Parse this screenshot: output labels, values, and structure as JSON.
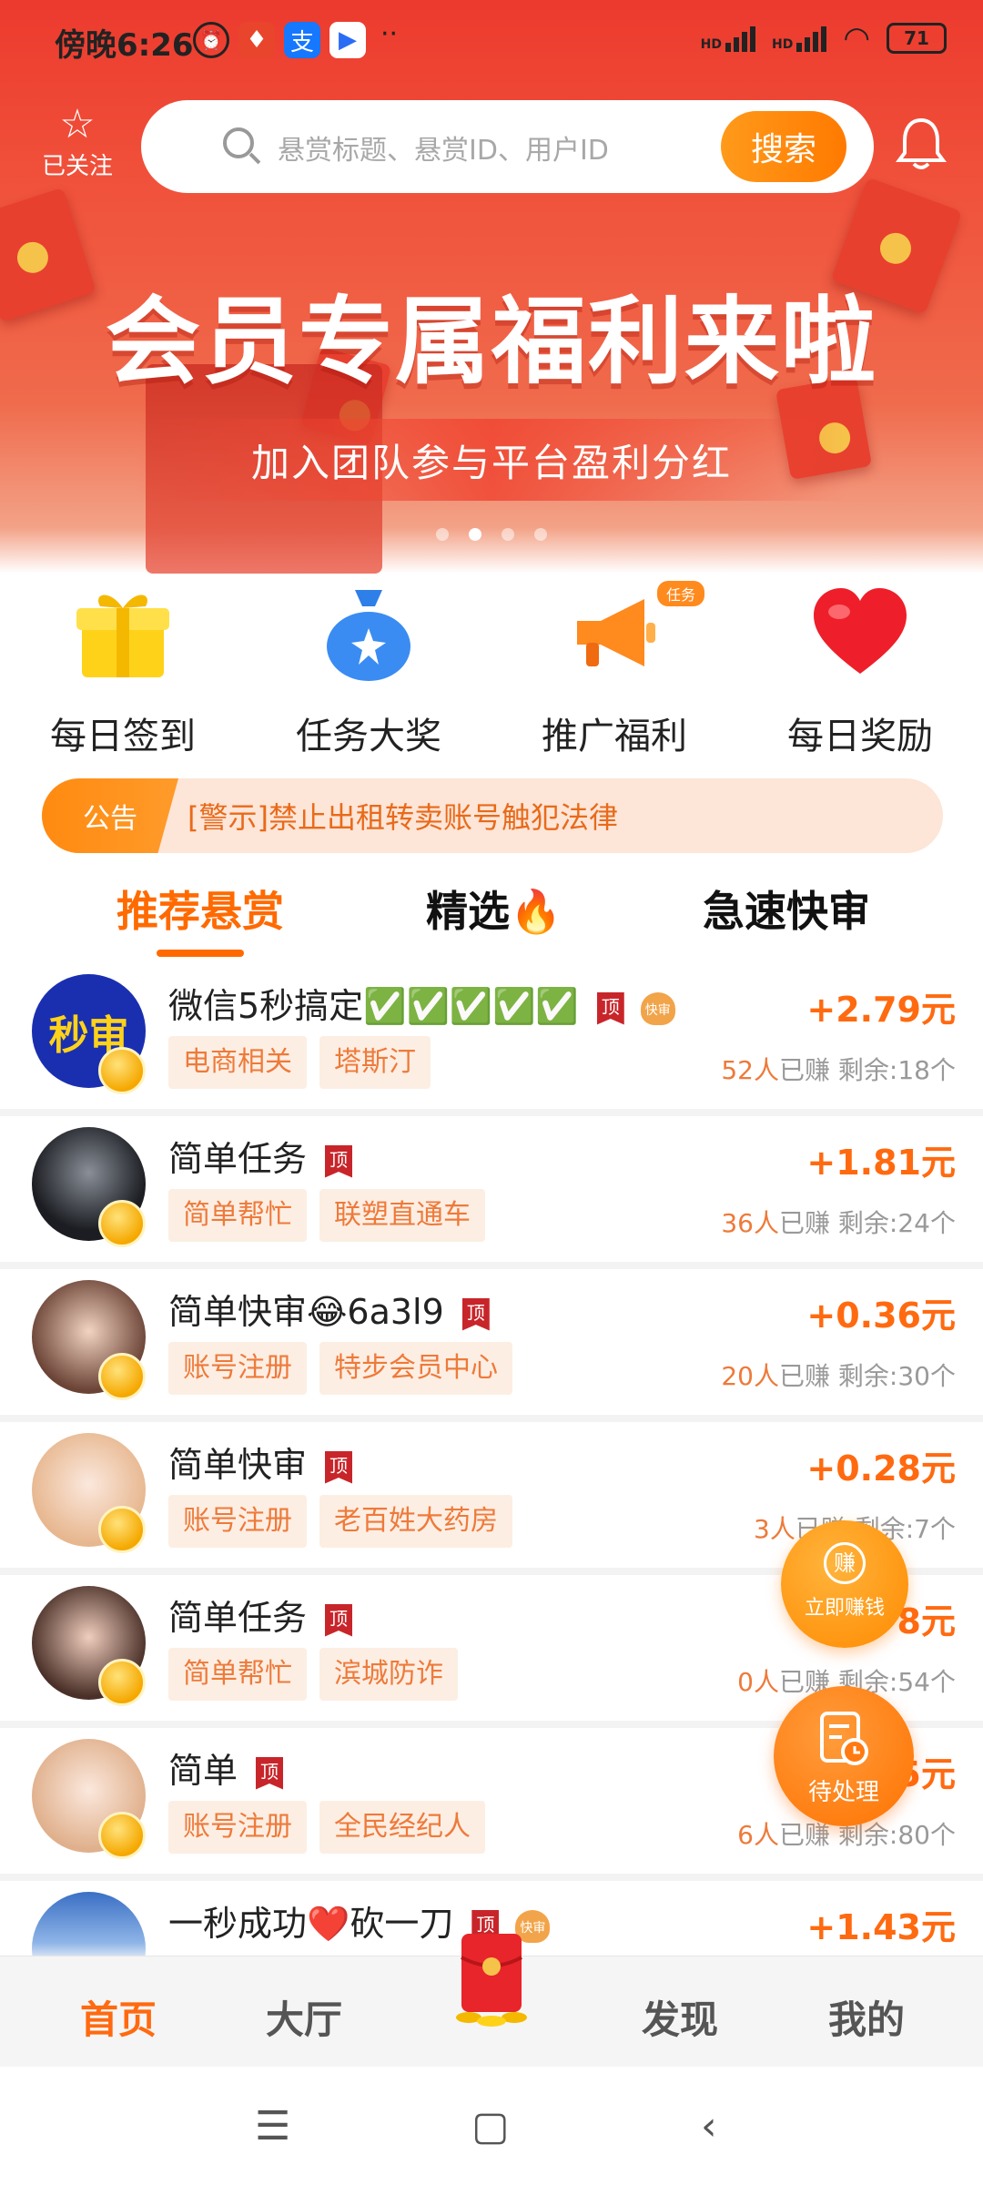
{
  "status_bar": {
    "time": "傍晚6:26",
    "battery": "71",
    "network_labels": [
      "HD",
      "HD"
    ]
  },
  "header": {
    "follow_label": "已关注",
    "search_placeholder": "悬赏标题、悬赏ID、用户ID",
    "search_button": "搜索"
  },
  "banner": {
    "title": "会员专属福利来啦",
    "subtitle": "加入团队参与平台盈利分红",
    "slide_count": 4,
    "active_slide": 2
  },
  "quick_menu": [
    {
      "label": "每日签到",
      "icon": "gift-icon"
    },
    {
      "label": "任务大奖",
      "icon": "money-bag-icon"
    },
    {
      "label": "推广福利",
      "icon": "megaphone-icon",
      "badge": "任务"
    },
    {
      "label": "每日奖励",
      "icon": "heart-icon"
    }
  ],
  "notice": {
    "tag": "公告",
    "text": "[警示]禁止出租转卖账号触犯法律"
  },
  "tabs": [
    {
      "label": "推荐悬赏",
      "active": true
    },
    {
      "label": "精选🔥",
      "active": false
    },
    {
      "label": "急速快审",
      "active": false
    }
  ],
  "tasks": [
    {
      "title": "微信5秒搞定✅✅✅✅✅",
      "tags": [
        "电商相关",
        "塔斯汀"
      ],
      "price": "+2.79元",
      "earned": "52人",
      "earned_suffix": "已赚",
      "remaining": "剩余:18个",
      "top": "顶",
      "fast": "快审",
      "avatar_text": "秒审"
    },
    {
      "title": "简单任务",
      "tags": [
        "简单帮忙",
        "联塑直通车"
      ],
      "price": "+1.81元",
      "earned": "36人",
      "earned_suffix": "已赚",
      "remaining": "剩余:24个",
      "top": "顶"
    },
    {
      "title": "简单快审😂6a3l9",
      "tags": [
        "账号注册",
        "特步会员中心"
      ],
      "price": "+0.36元",
      "earned": "20人",
      "earned_suffix": "已赚",
      "remaining": "剩余:30个",
      "top": "顶"
    },
    {
      "title": "简单快审",
      "tags": [
        "账号注册",
        "老百姓大药房"
      ],
      "price": "+0.28元",
      "earned": "3人",
      "earned_suffix": "已赚",
      "remaining": "剩余:7个",
      "top": "顶"
    },
    {
      "title": "简单任务",
      "tags": [
        "简单帮忙",
        "滨城防诈"
      ],
      "price": "8元",
      "earned": "0人",
      "earned_suffix": "已赚",
      "remaining": "剩余:54个",
      "top": "顶"
    },
    {
      "title": "简单",
      "tags": [
        "账号注册",
        "全民经纪人"
      ],
      "price": "5元",
      "earned": "6人",
      "earned_suffix": "已赚",
      "remaining": "剩余:80个",
      "top": "顶"
    },
    {
      "title": "一秒成功❤️砍一刀",
      "tags": [],
      "price": "+1.43元",
      "earned": "",
      "earned_suffix": "",
      "remaining": "",
      "top": "顶",
      "fast": "快审"
    }
  ],
  "floating": {
    "earn_icon_text": "赚",
    "earn_label": "立即赚钱",
    "pending_label": "待处理"
  },
  "bottom_nav": [
    {
      "label": "首页",
      "active": true
    },
    {
      "label": "大厅",
      "active": false
    },
    {
      "label": "发现",
      "active": false
    },
    {
      "label": "我的",
      "active": false
    }
  ],
  "system_nav": [
    "menu-icon",
    "home-icon",
    "back-icon"
  ],
  "colors": {
    "brand_red": "#ec3a2e",
    "accent_orange": "#ff6a10",
    "tag_bg": "#fdeee3"
  }
}
